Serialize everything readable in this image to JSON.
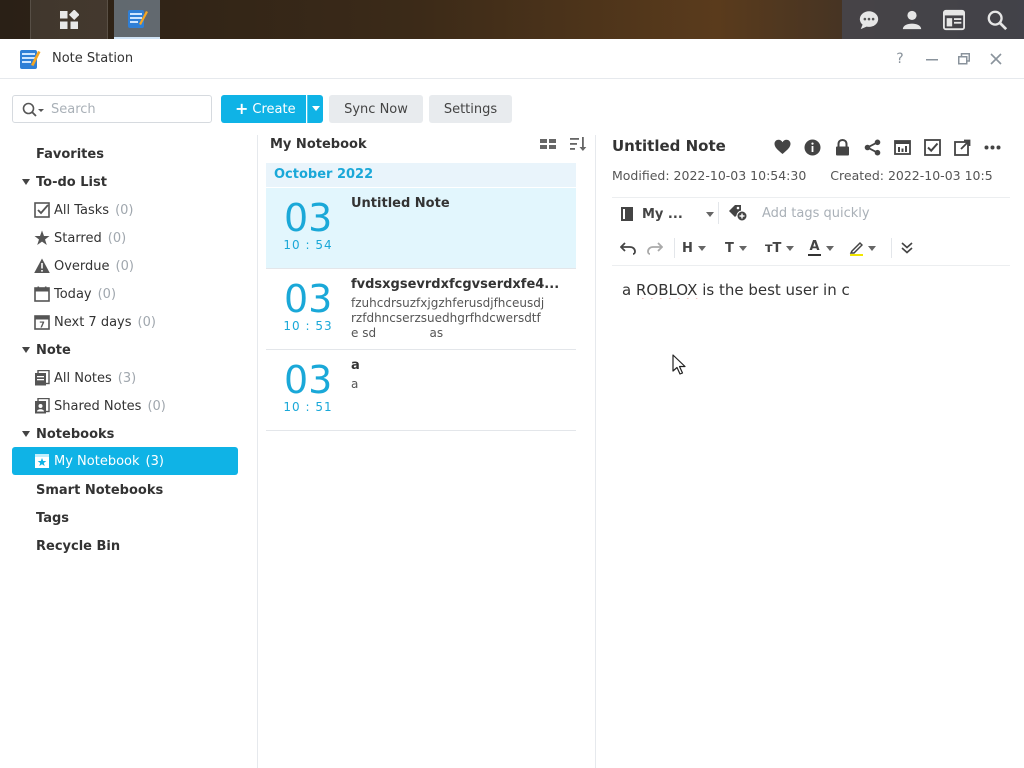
{
  "app": {
    "title": "Note Station"
  },
  "toolbar": {
    "search_placeholder": "Search",
    "create_label": "Create",
    "sync_label": "Sync Now",
    "settings_label": "Settings"
  },
  "sidebar": {
    "favorites": "Favorites",
    "todo_header": "To-do List",
    "todo_items": [
      {
        "label": "All Tasks",
        "count": "(0)"
      },
      {
        "label": "Starred",
        "count": "(0)"
      },
      {
        "label": "Overdue",
        "count": "(0)"
      },
      {
        "label": "Today",
        "count": "(0)"
      },
      {
        "label": "Next 7 days",
        "count": "(0)"
      }
    ],
    "note_header": "Note",
    "note_items": [
      {
        "label": "All Notes",
        "count": "(3)"
      },
      {
        "label": "Shared Notes",
        "count": "(0)"
      }
    ],
    "notebooks_header": "Notebooks",
    "notebook_item": {
      "label": "My Notebook",
      "count": "(3)"
    },
    "smart_notebooks": "Smart Notebooks",
    "tags": "Tags",
    "recycle_bin": "Recycle Bin"
  },
  "list": {
    "title": "My Notebook",
    "month": "October 2022",
    "notes": [
      {
        "day": "03",
        "time": "10 : 54",
        "title": "Untitled Note",
        "preview": ""
      },
      {
        "day": "03",
        "time": "10 : 53",
        "title": "fvdsxgsevrdxfcgvserdxfe4...",
        "preview": "fzuhcdrsuzfxjgzhferusdjfhceusdj\nrzfdhncserzsuedhgrfhdcwersdtf\ne sd              as"
      },
      {
        "day": "03",
        "time": "10 : 51",
        "title": "a",
        "preview": "a"
      }
    ]
  },
  "editor": {
    "title": "Untitled Note",
    "modified_label": "Modified:",
    "modified_value": "2022-10-03 10:54:30",
    "created_label": "Created:",
    "created_value": "2022-10-03 10:5",
    "notebook_select": "My ...",
    "tags_placeholder": "Add tags quickly",
    "format_h": "H",
    "format_t": "T",
    "format_size": "ᴛT",
    "format_color": "A",
    "body_prefix": "a ",
    "body_misspelled": "ROBLOX",
    "body_suffix": " is the best user in c"
  },
  "colors": {
    "accent": "#0fb3e6",
    "date_blue": "#1aa8d8",
    "selected_note_bg": "#e2f6fd",
    "month_bg": "#e9f4fb"
  }
}
